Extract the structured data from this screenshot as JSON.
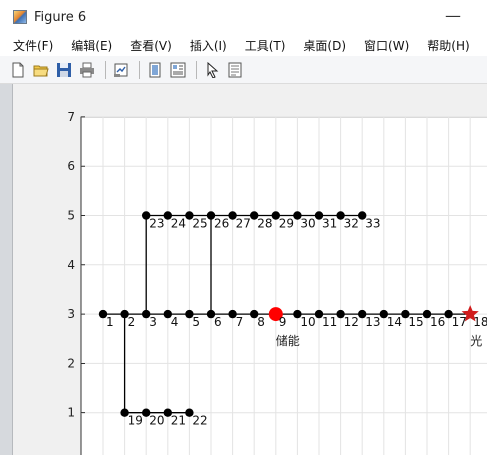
{
  "window": {
    "title": "Figure 6",
    "minimize_glyph": "—"
  },
  "menu": [
    {
      "label": "文件(F)"
    },
    {
      "label": "编辑(E)"
    },
    {
      "label": "查看(V)"
    },
    {
      "label": "插入(I)"
    },
    {
      "label": "工具(T)"
    },
    {
      "label": "桌面(D)"
    },
    {
      "label": "窗口(W)"
    },
    {
      "label": "帮助(H)"
    }
  ],
  "toolbar": [
    {
      "name": "new-figure-icon"
    },
    {
      "name": "open-file-icon"
    },
    {
      "name": "save-icon"
    },
    {
      "name": "print-icon"
    },
    {
      "name": "link-plot-icon"
    },
    {
      "name": "hide-plot-tools-icon"
    },
    {
      "name": "show-plot-tools-icon"
    },
    {
      "name": "edit-plot-arrow-icon"
    },
    {
      "name": "open-property-inspector-icon"
    }
  ],
  "chart_data": {
    "type": "scatter",
    "title": "",
    "xlabel": "",
    "ylabel": "",
    "ylim": [
      0,
      7
    ],
    "y_ticks": [
      "1",
      "2",
      "3",
      "4",
      "5",
      "6",
      "7"
    ],
    "grid": true,
    "nodes": [
      {
        "label": "1",
        "x": 1,
        "y": 3
      },
      {
        "label": "2",
        "x": 2,
        "y": 3
      },
      {
        "label": "3",
        "x": 3,
        "y": 3
      },
      {
        "label": "4",
        "x": 4,
        "y": 3
      },
      {
        "label": "5",
        "x": 5,
        "y": 3
      },
      {
        "label": "6",
        "x": 6,
        "y": 3
      },
      {
        "label": "7",
        "x": 7,
        "y": 3
      },
      {
        "label": "8",
        "x": 8,
        "y": 3
      },
      {
        "label": "9",
        "x": 9,
        "y": 3
      },
      {
        "label": "10",
        "x": 10,
        "y": 3
      },
      {
        "label": "11",
        "x": 11,
        "y": 3
      },
      {
        "label": "12",
        "x": 12,
        "y": 3
      },
      {
        "label": "13",
        "x": 13,
        "y": 3
      },
      {
        "label": "14",
        "x": 14,
        "y": 3
      },
      {
        "label": "15",
        "x": 15,
        "y": 3
      },
      {
        "label": "16",
        "x": 16,
        "y": 3
      },
      {
        "label": "17",
        "x": 17,
        "y": 3
      },
      {
        "label": "18",
        "x": 18,
        "y": 3
      },
      {
        "label": "19",
        "x": 2,
        "y": 1
      },
      {
        "label": "20",
        "x": 3,
        "y": 1
      },
      {
        "label": "21",
        "x": 4,
        "y": 1
      },
      {
        "label": "22",
        "x": 5,
        "y": 1
      },
      {
        "label": "23",
        "x": 3,
        "y": 5
      },
      {
        "label": "24",
        "x": 4,
        "y": 5
      },
      {
        "label": "25",
        "x": 5,
        "y": 5
      },
      {
        "label": "26",
        "x": 6,
        "y": 5
      },
      {
        "label": "27",
        "x": 7,
        "y": 5
      },
      {
        "label": "28",
        "x": 8,
        "y": 5
      },
      {
        "label": "29",
        "x": 9,
        "y": 5
      },
      {
        "label": "30",
        "x": 10,
        "y": 5
      },
      {
        "label": "31",
        "x": 11,
        "y": 5
      },
      {
        "label": "32",
        "x": 12,
        "y": 5
      },
      {
        "label": "33",
        "x": 13,
        "y": 5
      }
    ],
    "edges": [
      [
        1,
        2
      ],
      [
        2,
        3
      ],
      [
        3,
        4
      ],
      [
        4,
        5
      ],
      [
        5,
        6
      ],
      [
        6,
        7
      ],
      [
        7,
        8
      ],
      [
        8,
        9
      ],
      [
        9,
        10
      ],
      [
        10,
        11
      ],
      [
        11,
        12
      ],
      [
        12,
        13
      ],
      [
        13,
        14
      ],
      [
        14,
        15
      ],
      [
        15,
        16
      ],
      [
        16,
        17
      ],
      [
        17,
        18
      ],
      [
        2,
        19
      ],
      [
        19,
        20
      ],
      [
        20,
        21
      ],
      [
        21,
        22
      ],
      [
        3,
        23
      ],
      [
        23,
        24
      ],
      [
        24,
        25
      ],
      [
        25,
        26
      ],
      [
        26,
        27
      ],
      [
        27,
        28
      ],
      [
        28,
        29
      ],
      [
        29,
        30
      ],
      [
        30,
        31
      ],
      [
        31,
        32
      ],
      [
        32,
        33
      ],
      [
        6,
        26
      ]
    ],
    "special_nodes": [
      {
        "node": "9",
        "marker": "circle",
        "color": "#ff0000",
        "annotation": "储能"
      },
      {
        "node": "18",
        "marker": "star",
        "color": "#d01c1c",
        "annotation": "光"
      }
    ],
    "node_color": "#000000",
    "line_color": "#000000"
  }
}
